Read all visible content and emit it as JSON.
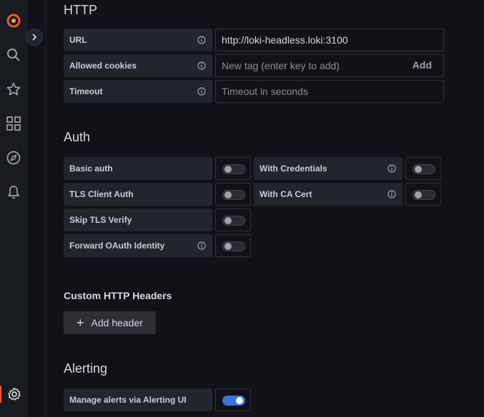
{
  "sidebar": {
    "icons": [
      "grafana-logo-icon",
      "search-icon",
      "star-icon",
      "dashboards-icon",
      "explore-icon",
      "alerting-icon",
      "settings-icon"
    ]
  },
  "http": {
    "title": "HTTP",
    "url_label": "URL",
    "url_value": "http://loki-headless.loki:3100",
    "cookies_label": "Allowed cookies",
    "cookies_placeholder": "New tag (enter key to add)",
    "cookies_add": "Add",
    "timeout_label": "Timeout",
    "timeout_placeholder": "Timeout in seconds"
  },
  "auth": {
    "title": "Auth",
    "basic_auth": "Basic auth",
    "with_credentials": "With Credentials",
    "tls_client_auth": "TLS Client Auth",
    "with_ca_cert": "With CA Cert",
    "skip_tls_verify": "Skip TLS Verify",
    "forward_oauth": "Forward OAuth Identity"
  },
  "custom_headers": {
    "title": "Custom HTTP Headers",
    "add_header": "Add header"
  },
  "alerting": {
    "title": "Alerting",
    "manage_alerts": "Manage alerts via Alerting UI",
    "manage_alerts_enabled": true
  },
  "colors": {
    "accent": "#3d71d9",
    "logo": "#f05a28"
  }
}
